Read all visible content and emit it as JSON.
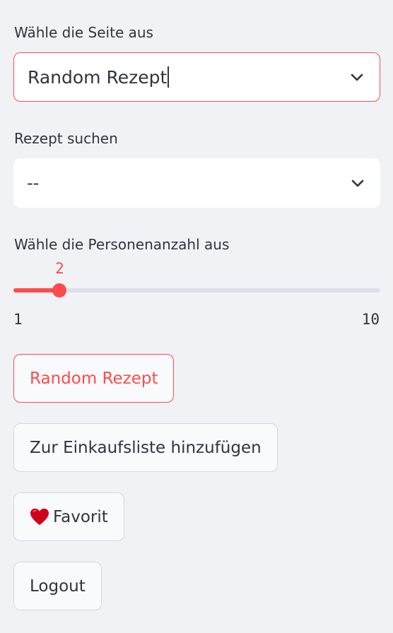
{
  "page_select": {
    "label": "Wähle die Seite aus",
    "value": "Random Rezept"
  },
  "recipe_search": {
    "label": "Rezept suchen",
    "value": "--"
  },
  "persons_slider": {
    "label": "Wähle die Personenanzahl aus",
    "value": 2,
    "min": 1,
    "max": 10,
    "min_label": "1",
    "max_label": "10",
    "value_label": "2"
  },
  "buttons": {
    "random": "Random Rezept",
    "shopping_list": "Zur Einkaufsliste hinzufügen",
    "favorite": "Favorit",
    "logout": "Logout"
  },
  "icons": {
    "select_arrow": "chevron-down-icon",
    "favorite": "heart-icon"
  },
  "colors": {
    "accent": "#ff4b4b",
    "background": "#f0f2f6",
    "text": "#31333f",
    "track": "#dde0e6"
  }
}
